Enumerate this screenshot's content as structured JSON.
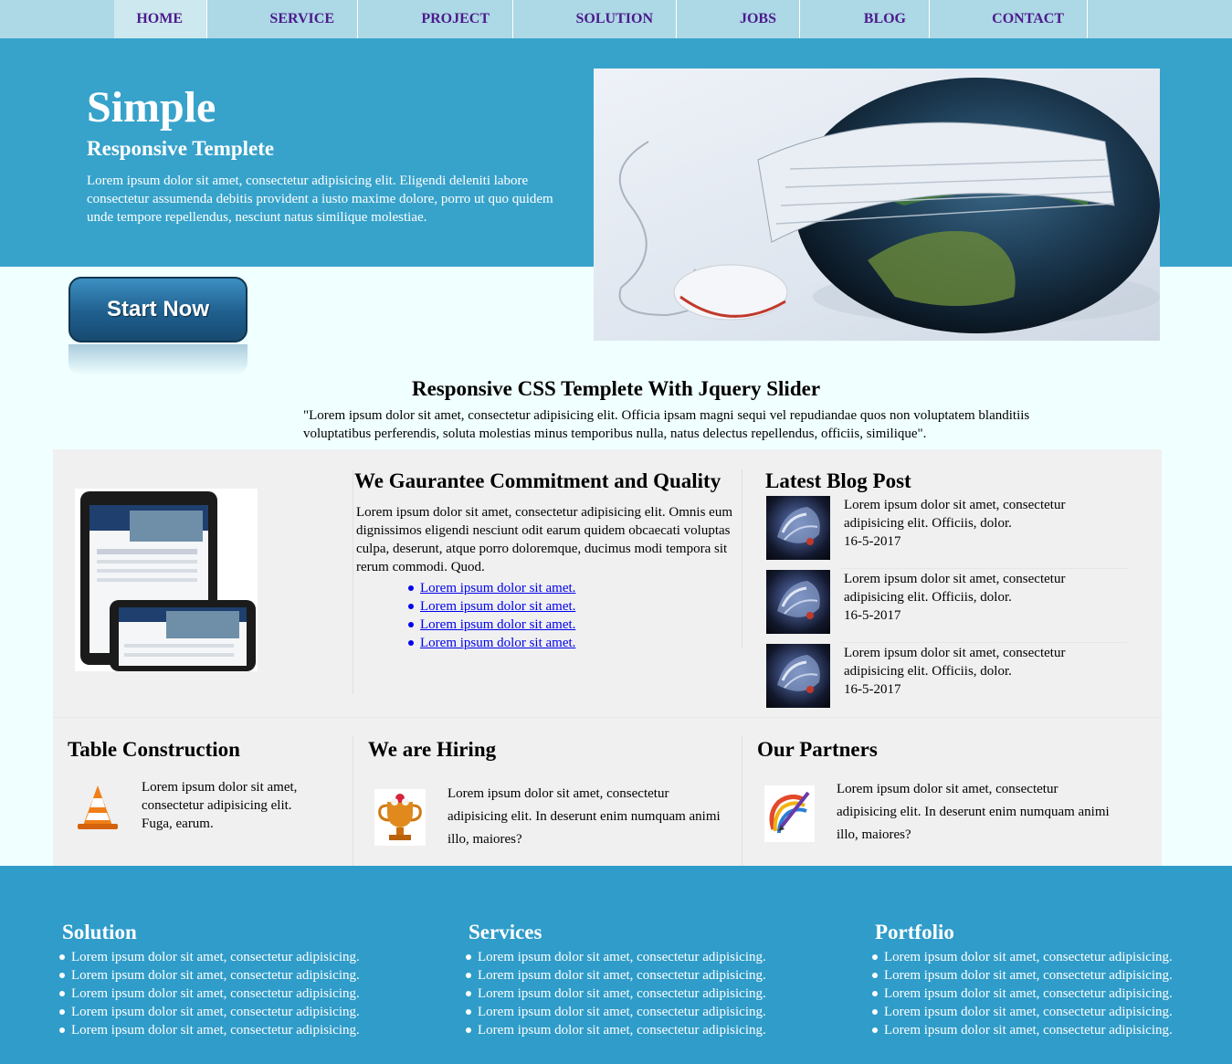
{
  "nav": {
    "items": [
      {
        "label": "HOME"
      },
      {
        "label": "SERVICE"
      },
      {
        "label": "PROJECT"
      },
      {
        "label": "SOLUTION"
      },
      {
        "label": "JOBS"
      },
      {
        "label": "BLOG"
      },
      {
        "label": "CONTACT"
      }
    ],
    "active": "HOME"
  },
  "hero": {
    "title": "Simple",
    "subtitle": "Responsive Templete",
    "text": "Lorem ipsum dolor sit amet, consectetur adipisicing elit. Eligendi deleniti labore consectetur assumenda debitis provident a iusto maxime dolore, porro ut quo quidem unde tempore repellendus, nesciunt natus similique molestiae.",
    "image": "globe-keyboard-mouse-image",
    "button_label": "Start Now"
  },
  "intro": {
    "title": "Responsive CSS Templete With Jquery Slider",
    "text": "\"Lorem ipsum dolor sit amet, consectetur adipisicing elit. Officia ipsam magni sequi vel repudiandae quos non voluptatem blanditiis voluptatibus perferendis, soluta molestias minus temporibus nulla, natus delectus repellendus, officiis, similique\"."
  },
  "guarantee": {
    "title": "We Gaurantee Commitment and Quality",
    "text": "Lorem ipsum dolor sit amet, consectetur adipisicing elit. Omnis eum dignissimos eligendi nesciunt odit earum quidem obcaecati voluptas culpa, deserunt, atque porro doloremque, ducimus modi tempora sit rerum commodi. Quod.",
    "links": [
      "Lorem ipsum dolor sit amet.",
      "Lorem ipsum dolor sit amet.",
      "Lorem ipsum dolor sit amet.",
      "Lorem ipsum dolor sit amet."
    ]
  },
  "blog": {
    "title": "Latest Blog Post",
    "posts": [
      {
        "text": "Lorem ipsum dolor sit amet, consectetur adipisicing elit. Officiis, dolor.",
        "date": "16-5-2017"
      },
      {
        "text": "Lorem ipsum dolor sit amet, consectetur adipisicing elit. Officiis, dolor.",
        "date": "16-5-2017"
      },
      {
        "text": "Lorem ipsum dolor sit amet, consectetur adipisicing elit. Officiis, dolor.",
        "date": "16-5-2017"
      }
    ]
  },
  "sections": [
    {
      "title": "Table Construction",
      "text": "Lorem ipsum dolor sit amet, consectetur adipisicing elit. Fuga, earum.",
      "icon": "traffic-cone-icon"
    },
    {
      "title": "We are Hiring",
      "text": "Lorem ipsum dolor sit amet, consectetur adipisicing elit. In deserunt enim numquam animi illo, maiores?",
      "icon": "trophy-icon"
    },
    {
      "title": "Our Partners",
      "text": "Lorem ipsum dolor sit amet, consectetur adipisicing elit. In deserunt enim numquam animi illo, maiores?",
      "icon": "paint-pen-icon"
    }
  ],
  "footer": {
    "columns": [
      {
        "title": "Solution",
        "items": [
          "Lorem ipsum dolor sit amet, consectetur adipisicing.",
          "Lorem ipsum dolor sit amet, consectetur adipisicing.",
          "Lorem ipsum dolor sit amet, consectetur adipisicing.",
          "Lorem ipsum dolor sit amet, consectetur adipisicing.",
          "Lorem ipsum dolor sit amet, consectetur adipisicing."
        ]
      },
      {
        "title": "Services",
        "items": [
          "Lorem ipsum dolor sit amet, consectetur adipisicing.",
          "Lorem ipsum dolor sit amet, consectetur adipisicing.",
          "Lorem ipsum dolor sit amet, consectetur adipisicing.",
          "Lorem ipsum dolor sit amet, consectetur adipisicing.",
          "Lorem ipsum dolor sit amet, consectetur adipisicing."
        ]
      },
      {
        "title": "Portfolio",
        "items": [
          "Lorem ipsum dolor sit amet, consectetur adipisicing.",
          "Lorem ipsum dolor sit amet, consectetur adipisicing.",
          "Lorem ipsum dolor sit amet, consectetur adipisicing.",
          "Lorem ipsum dolor sit amet, consectetur adipisicing.",
          "Lorem ipsum dolor sit amet, consectetur adipisicing."
        ]
      }
    ]
  },
  "colors": {
    "nav_bg": "#add8e6",
    "nav_text": "#4b1b8c",
    "hero_bg": "#37a3cb",
    "page_bg": "#f0ffff",
    "panel_bg": "#f0f0f0",
    "footer_bg": "#2f9cc9",
    "link": "#0000ee"
  }
}
